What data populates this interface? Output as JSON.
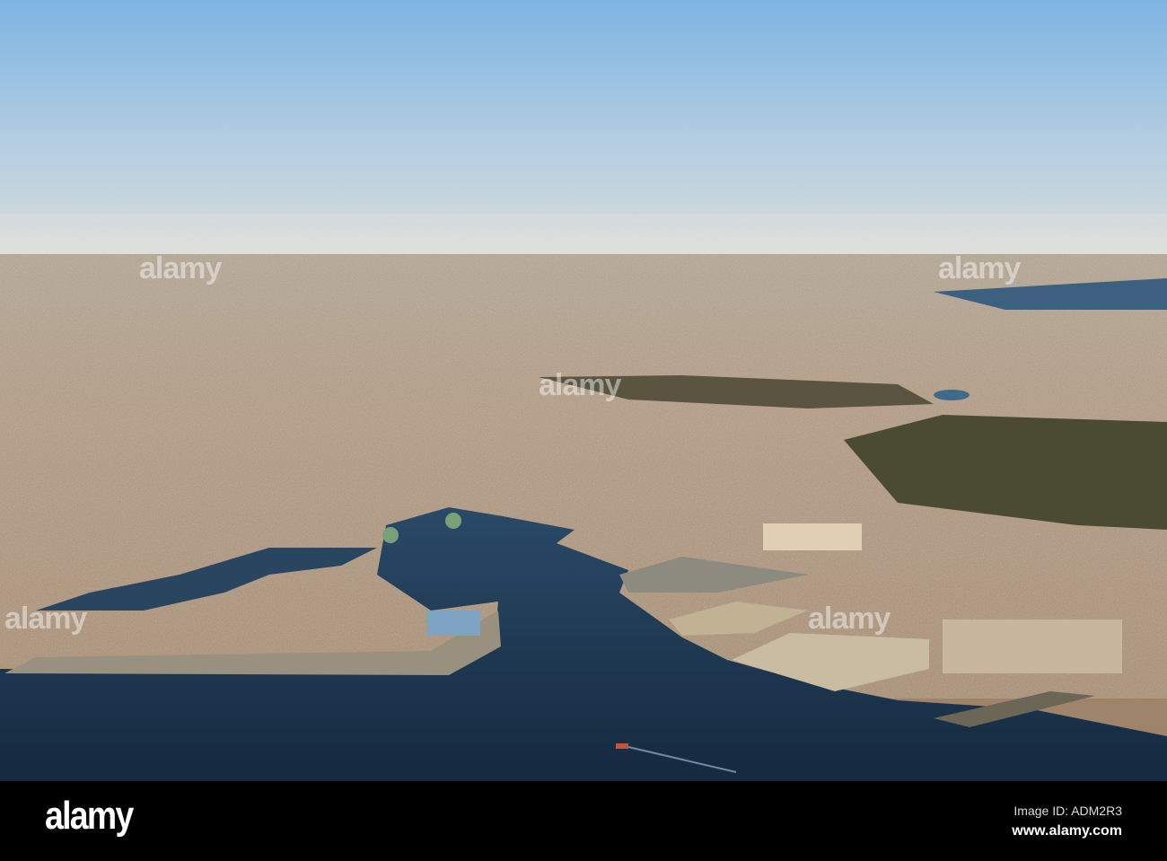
{
  "watermark": {
    "text": "alamy"
  },
  "footer": {
    "logo": "alamy",
    "image_id": "Image ID: ADM2R3",
    "url": "www.alamy.com"
  },
  "colors": {
    "sky_top": "#7db5e2",
    "sky_horizon": "#d9dcdc",
    "city": "#a38d72",
    "water": "#1d3651",
    "park": "#4a4a35"
  }
}
